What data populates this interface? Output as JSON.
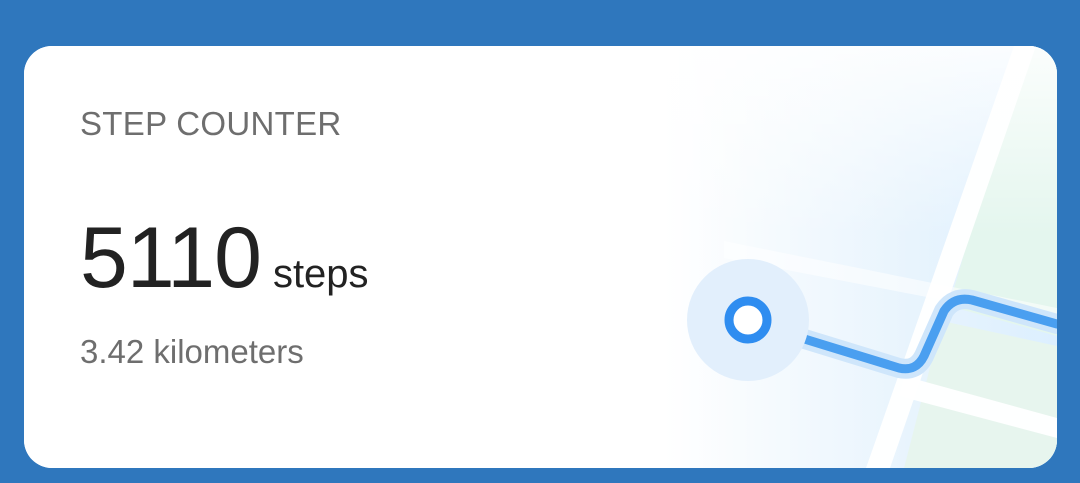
{
  "card": {
    "title": "STEP COUNTER",
    "steps_value": "5110",
    "steps_unit": "steps",
    "distance": "3.42 kilometers"
  },
  "colors": {
    "background": "#2f77bd",
    "card": "#ffffff",
    "title_text": "#6e6e6e",
    "value_text": "#222222",
    "route": "#4a9ff0",
    "route_marker": "#2f8df0",
    "map_park": "#e4f6ee"
  },
  "icons": {
    "route_start": "location-marker-icon",
    "route_path": "route-path-icon"
  }
}
